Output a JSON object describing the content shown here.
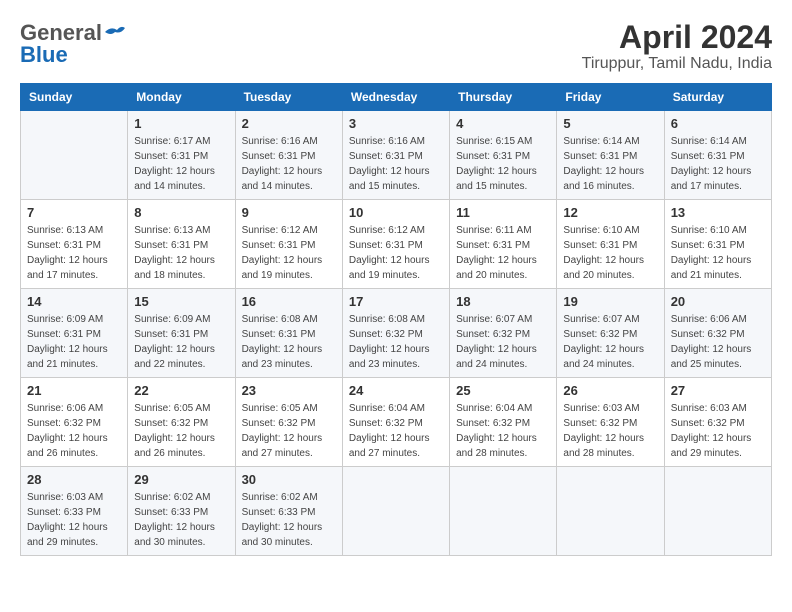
{
  "header": {
    "logo": {
      "general": "General",
      "blue": "Blue"
    },
    "title": "April 2024",
    "subtitle": "Tiruppur, Tamil Nadu, India"
  },
  "calendar": {
    "weekdays": [
      "Sunday",
      "Monday",
      "Tuesday",
      "Wednesday",
      "Thursday",
      "Friday",
      "Saturday"
    ],
    "weeks": [
      [
        {
          "day": "",
          "sunrise": "",
          "sunset": "",
          "daylight": ""
        },
        {
          "day": "1",
          "sunrise": "Sunrise: 6:17 AM",
          "sunset": "Sunset: 6:31 PM",
          "daylight": "Daylight: 12 hours and 14 minutes."
        },
        {
          "day": "2",
          "sunrise": "Sunrise: 6:16 AM",
          "sunset": "Sunset: 6:31 PM",
          "daylight": "Daylight: 12 hours and 14 minutes."
        },
        {
          "day": "3",
          "sunrise": "Sunrise: 6:16 AM",
          "sunset": "Sunset: 6:31 PM",
          "daylight": "Daylight: 12 hours and 15 minutes."
        },
        {
          "day": "4",
          "sunrise": "Sunrise: 6:15 AM",
          "sunset": "Sunset: 6:31 PM",
          "daylight": "Daylight: 12 hours and 15 minutes."
        },
        {
          "day": "5",
          "sunrise": "Sunrise: 6:14 AM",
          "sunset": "Sunset: 6:31 PM",
          "daylight": "Daylight: 12 hours and 16 minutes."
        },
        {
          "day": "6",
          "sunrise": "Sunrise: 6:14 AM",
          "sunset": "Sunset: 6:31 PM",
          "daylight": "Daylight: 12 hours and 17 minutes."
        }
      ],
      [
        {
          "day": "7",
          "sunrise": "Sunrise: 6:13 AM",
          "sunset": "Sunset: 6:31 PM",
          "daylight": "Daylight: 12 hours and 17 minutes."
        },
        {
          "day": "8",
          "sunrise": "Sunrise: 6:13 AM",
          "sunset": "Sunset: 6:31 PM",
          "daylight": "Daylight: 12 hours and 18 minutes."
        },
        {
          "day": "9",
          "sunrise": "Sunrise: 6:12 AM",
          "sunset": "Sunset: 6:31 PM",
          "daylight": "Daylight: 12 hours and 19 minutes."
        },
        {
          "day": "10",
          "sunrise": "Sunrise: 6:12 AM",
          "sunset": "Sunset: 6:31 PM",
          "daylight": "Daylight: 12 hours and 19 minutes."
        },
        {
          "day": "11",
          "sunrise": "Sunrise: 6:11 AM",
          "sunset": "Sunset: 6:31 PM",
          "daylight": "Daylight: 12 hours and 20 minutes."
        },
        {
          "day": "12",
          "sunrise": "Sunrise: 6:10 AM",
          "sunset": "Sunset: 6:31 PM",
          "daylight": "Daylight: 12 hours and 20 minutes."
        },
        {
          "day": "13",
          "sunrise": "Sunrise: 6:10 AM",
          "sunset": "Sunset: 6:31 PM",
          "daylight": "Daylight: 12 hours and 21 minutes."
        }
      ],
      [
        {
          "day": "14",
          "sunrise": "Sunrise: 6:09 AM",
          "sunset": "Sunset: 6:31 PM",
          "daylight": "Daylight: 12 hours and 21 minutes."
        },
        {
          "day": "15",
          "sunrise": "Sunrise: 6:09 AM",
          "sunset": "Sunset: 6:31 PM",
          "daylight": "Daylight: 12 hours and 22 minutes."
        },
        {
          "day": "16",
          "sunrise": "Sunrise: 6:08 AM",
          "sunset": "Sunset: 6:31 PM",
          "daylight": "Daylight: 12 hours and 23 minutes."
        },
        {
          "day": "17",
          "sunrise": "Sunrise: 6:08 AM",
          "sunset": "Sunset: 6:32 PM",
          "daylight": "Daylight: 12 hours and 23 minutes."
        },
        {
          "day": "18",
          "sunrise": "Sunrise: 6:07 AM",
          "sunset": "Sunset: 6:32 PM",
          "daylight": "Daylight: 12 hours and 24 minutes."
        },
        {
          "day": "19",
          "sunrise": "Sunrise: 6:07 AM",
          "sunset": "Sunset: 6:32 PM",
          "daylight": "Daylight: 12 hours and 24 minutes."
        },
        {
          "day": "20",
          "sunrise": "Sunrise: 6:06 AM",
          "sunset": "Sunset: 6:32 PM",
          "daylight": "Daylight: 12 hours and 25 minutes."
        }
      ],
      [
        {
          "day": "21",
          "sunrise": "Sunrise: 6:06 AM",
          "sunset": "Sunset: 6:32 PM",
          "daylight": "Daylight: 12 hours and 26 minutes."
        },
        {
          "day": "22",
          "sunrise": "Sunrise: 6:05 AM",
          "sunset": "Sunset: 6:32 PM",
          "daylight": "Daylight: 12 hours and 26 minutes."
        },
        {
          "day": "23",
          "sunrise": "Sunrise: 6:05 AM",
          "sunset": "Sunset: 6:32 PM",
          "daylight": "Daylight: 12 hours and 27 minutes."
        },
        {
          "day": "24",
          "sunrise": "Sunrise: 6:04 AM",
          "sunset": "Sunset: 6:32 PM",
          "daylight": "Daylight: 12 hours and 27 minutes."
        },
        {
          "day": "25",
          "sunrise": "Sunrise: 6:04 AM",
          "sunset": "Sunset: 6:32 PM",
          "daylight": "Daylight: 12 hours and 28 minutes."
        },
        {
          "day": "26",
          "sunrise": "Sunrise: 6:03 AM",
          "sunset": "Sunset: 6:32 PM",
          "daylight": "Daylight: 12 hours and 28 minutes."
        },
        {
          "day": "27",
          "sunrise": "Sunrise: 6:03 AM",
          "sunset": "Sunset: 6:32 PM",
          "daylight": "Daylight: 12 hours and 29 minutes."
        }
      ],
      [
        {
          "day": "28",
          "sunrise": "Sunrise: 6:03 AM",
          "sunset": "Sunset: 6:33 PM",
          "daylight": "Daylight: 12 hours and 29 minutes."
        },
        {
          "day": "29",
          "sunrise": "Sunrise: 6:02 AM",
          "sunset": "Sunset: 6:33 PM",
          "daylight": "Daylight: 12 hours and 30 minutes."
        },
        {
          "day": "30",
          "sunrise": "Sunrise: 6:02 AM",
          "sunset": "Sunset: 6:33 PM",
          "daylight": "Daylight: 12 hours and 30 minutes."
        },
        {
          "day": "",
          "sunrise": "",
          "sunset": "",
          "daylight": ""
        },
        {
          "day": "",
          "sunrise": "",
          "sunset": "",
          "daylight": ""
        },
        {
          "day": "",
          "sunrise": "",
          "sunset": "",
          "daylight": ""
        },
        {
          "day": "",
          "sunrise": "",
          "sunset": "",
          "daylight": ""
        }
      ]
    ]
  }
}
